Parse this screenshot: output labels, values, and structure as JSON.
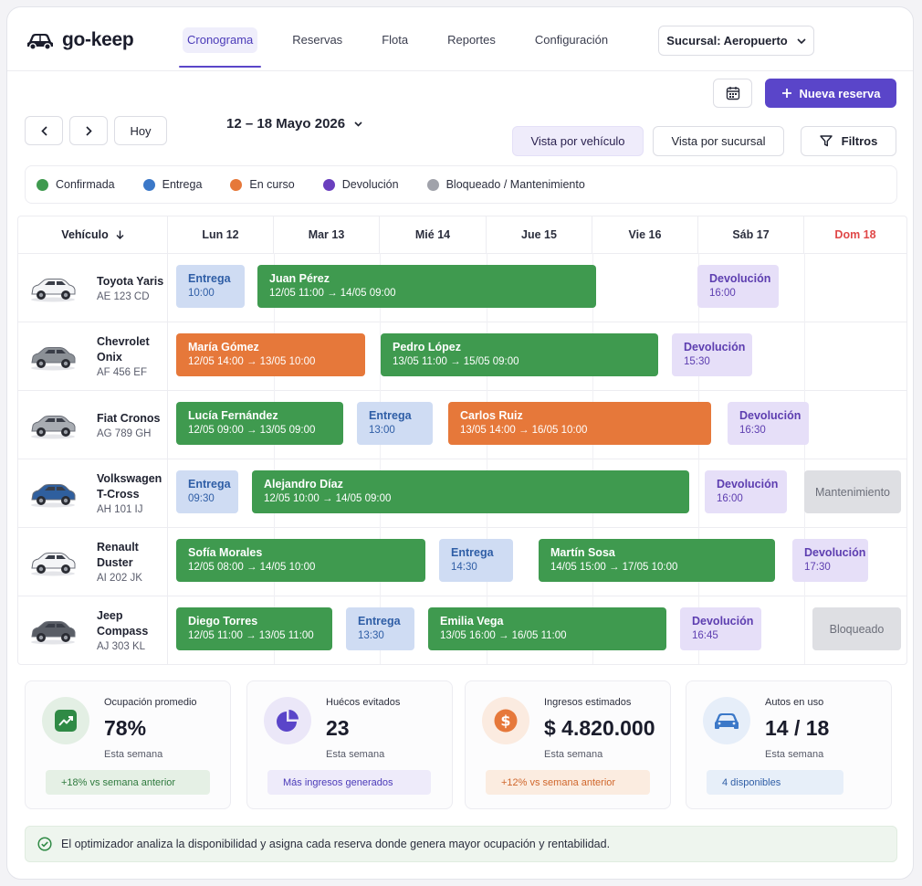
{
  "app": {
    "name": "go-keep",
    "nav": [
      "Cronograma",
      "Reservas",
      "Flota",
      "Reportes",
      "Configuración"
    ],
    "active_nav": "Cronograma",
    "branch_label": "Sucursal: Aeropuerto"
  },
  "toolbar": {
    "new_reservation": "Nueva reserva",
    "today": "Hoy",
    "date_range": "12 – 18 Mayo 2026",
    "view_vehicle": "Vista por vehículo",
    "view_branch": "Vista por sucursal",
    "filters": "Filtros"
  },
  "legend": [
    {
      "label": "Confirmada",
      "color": "#3f9a4f"
    },
    {
      "label": "Entrega",
      "color": "#3b78c8"
    },
    {
      "label": "En curso",
      "color": "#e6783a"
    },
    {
      "label": "Devolución",
      "color": "#6a3fbe"
    },
    {
      "label": "Bloqueado / Mantenimiento",
      "color": "#a0a2aa"
    }
  ],
  "schedule": {
    "vehicle_header": "Vehículo",
    "days": [
      "Lun 12",
      "Mar 13",
      "Mié 14",
      "Jue 15",
      "Vie 16",
      "Sáb 17",
      "Dom 18"
    ],
    "vehicles": [
      {
        "name": "Toyota Yaris",
        "plate": "AE 123 CD",
        "color": "#f4f5f7"
      },
      {
        "name": "Chevrolet Onix",
        "plate": "AF 456 EF",
        "color": "#8b9096"
      },
      {
        "name": "Fiat Cronos",
        "plate": "AG 789 GH",
        "color": "#a8acb2"
      },
      {
        "name": "Volkswagen T-Cross",
        "plate": "AH 101 IJ",
        "color": "#2f5f9e"
      },
      {
        "name": "Renault Duster",
        "plate": "AI 202 JK",
        "color": "#f4f5f7"
      },
      {
        "name": "Jeep Compass",
        "plate": "AJ 303 KL",
        "color": "#5a5e66"
      }
    ],
    "reservations": [
      {
        "row": 0,
        "kind": "entrega",
        "title": "Entrega",
        "sub": "10:00"
      },
      {
        "row": 0,
        "kind": "confirmada",
        "title": "Juan Pérez",
        "sub": "12/05 11:00 → 14/05 09:00"
      },
      {
        "row": 0,
        "kind": "devolucion",
        "title": "Devolución",
        "sub": "16:00"
      },
      {
        "row": 1,
        "kind": "en_curso",
        "title": "María Gómez",
        "sub": "12/05 14:00 → 13/05 10:00"
      },
      {
        "row": 1,
        "kind": "confirmada",
        "title": "Pedro López",
        "sub": "13/05 11:00 → 15/05 09:00"
      },
      {
        "row": 1,
        "kind": "devolucion",
        "title": "Devolución",
        "sub": "15:30"
      },
      {
        "row": 2,
        "kind": "confirmada",
        "title": "Lucía Fernández",
        "sub": "12/05 09:00 → 13/05 09:00"
      },
      {
        "row": 2,
        "kind": "entrega",
        "title": "Entrega",
        "sub": "13:00"
      },
      {
        "row": 2,
        "kind": "en_curso",
        "title": "Carlos Ruiz",
        "sub": "13/05 14:00 → 16/05 10:00"
      },
      {
        "row": 2,
        "kind": "devolucion",
        "title": "Devolución",
        "sub": "16:30"
      },
      {
        "row": 3,
        "kind": "entrega",
        "title": "Entrega",
        "sub": "09:30"
      },
      {
        "row": 3,
        "kind": "confirmada",
        "title": "Alejandro Díaz",
        "sub": "12/05 10:00 → 14/05 09:00"
      },
      {
        "row": 3,
        "kind": "devolucion",
        "title": "Devolución",
        "sub": "16:00"
      },
      {
        "row": 3,
        "kind": "bloqueado",
        "title": "Mantenimiento",
        "sub": ""
      },
      {
        "row": 4,
        "kind": "confirmada",
        "title": "Sofía Morales",
        "sub": "12/05 08:00 → 14/05 10:00"
      },
      {
        "row": 4,
        "kind": "entrega",
        "title": "Entrega",
        "sub": "14:30"
      },
      {
        "row": 4,
        "kind": "confirmada",
        "title": "Martín Sosa",
        "sub": "14/05 15:00 → 17/05 10:00"
      },
      {
        "row": 4,
        "kind": "devolucion",
        "title": "Devolución",
        "sub": "17:30"
      },
      {
        "row": 5,
        "kind": "confirmada",
        "title": "Diego Torres",
        "sub": "12/05 11:00 → 13/05 11:00"
      },
      {
        "row": 5,
        "kind": "entrega",
        "title": "Entrega",
        "sub": "13:30"
      },
      {
        "row": 5,
        "kind": "confirmada",
        "title": "Emilia Vega",
        "sub": "13/05 16:00 → 16/05 11:00"
      },
      {
        "row": 5,
        "kind": "devolucion",
        "title": "Devolución",
        "sub": "16:45"
      },
      {
        "row": 5,
        "kind": "bloqueado",
        "title": "Bloqueado",
        "sub": ""
      }
    ]
  },
  "stats": [
    {
      "label": "Ocupación promedio",
      "value": "78%",
      "sub": "Esta semana",
      "chip": "+18% vs semana anterior",
      "icon": "trend-up-icon",
      "accent": "#2f8a45"
    },
    {
      "label": "Huécos evitados",
      "value": "23",
      "sub": "Esta semana",
      "chip": "Más ingresos generados",
      "icon": "pie-chart-icon",
      "accent": "#5a45c9"
    },
    {
      "label": "Ingresos estimados",
      "value": "$ 4.820.000",
      "sub": "Esta semana",
      "chip": "+12% vs semana anterior",
      "icon": "dollar-icon",
      "accent": "#e6783a"
    },
    {
      "label": "Autos en uso",
      "value": "14 / 18",
      "sub": "Esta semana",
      "chip": "4 disponibles",
      "icon": "car-icon",
      "accent": "#3b78c8"
    }
  ],
  "notice": "El optimizador analiza la disponibilidad y asigna cada reserva donde genera mayor ocupación y rentabilidad."
}
